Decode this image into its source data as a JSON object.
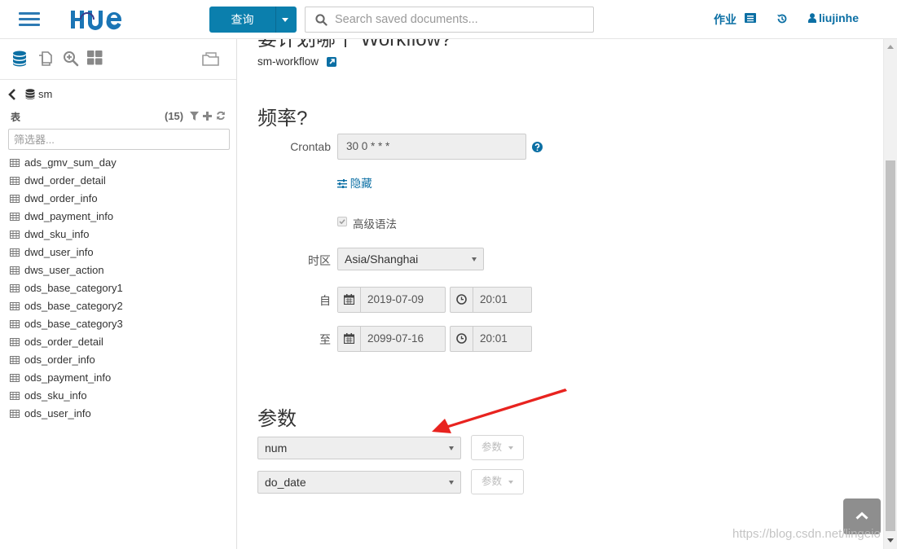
{
  "colors": {
    "accent": "#0b7fad",
    "link": "#0b6fa4",
    "hamburger": "#2d7ab3"
  },
  "header": {
    "logo": "HUE",
    "query_button": "查询",
    "search_placeholder": "Search saved documents...",
    "jobs_label": "作业",
    "username": "liujinhe",
    "icons": [
      "hamburger-icon",
      "search-icon",
      "jobs-list-icon",
      "history-icon",
      "user-icon"
    ]
  },
  "sidebar": {
    "icons": [
      "database-icon",
      "documents-icon",
      "search-plus-icon",
      "dashboard-icon",
      "folder-icon"
    ],
    "database": "sm",
    "tables_label": "表",
    "tables_count": "(15)",
    "filter_placeholder": "筛选器...",
    "tables": [
      "ads_gmv_sum_day",
      "dwd_order_detail",
      "dwd_order_info",
      "dwd_payment_info",
      "dwd_sku_info",
      "dwd_user_info",
      "dws_user_action",
      "ods_base_category1",
      "ods_base_category2",
      "ods_base_category3",
      "ods_order_detail",
      "ods_order_info",
      "ods_payment_info",
      "ods_sku_info",
      "ods_user_info"
    ]
  },
  "main": {
    "workflow_section_title": "要计划哪个 Workflow?",
    "workflow_link": "sm-workflow",
    "frequency_title": "频率?",
    "crontab_label": "Crontab",
    "crontab_value": "30 0 * * *",
    "hide_link": "隐藏",
    "advanced_syntax_label": "高级语法",
    "timezone_label": "时区",
    "timezone_value": "Asia/Shanghai",
    "from_label": "自",
    "from_date": "2019-07-09",
    "from_time": "20:01",
    "to_label": "至",
    "to_date": "2099-07-16",
    "to_time": "20:01",
    "params_title": "参数",
    "params": [
      {
        "name": "num",
        "button": "参数"
      },
      {
        "name": "do_date",
        "button": "参数"
      }
    ]
  },
  "watermark": "https://blog.csdn.net/lingeio"
}
